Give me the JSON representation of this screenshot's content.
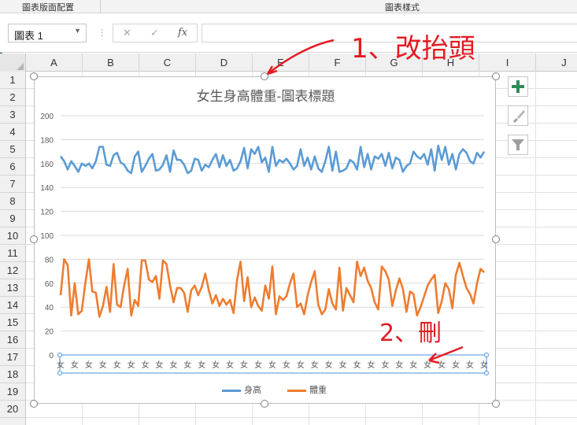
{
  "ribbon": {
    "group1": "圖表版面配置",
    "group2": "圖表樣式"
  },
  "formula_bar": {
    "name_box": "圖表 1",
    "cancel_icon": "✕",
    "enter_icon": "✓",
    "fx_icon": "fx",
    "value": ""
  },
  "columns": [
    "A",
    "B",
    "C",
    "D",
    "E",
    "F",
    "G",
    "H",
    "I",
    "J"
  ],
  "rows": [
    "1",
    "2",
    "3",
    "4",
    "5",
    "6",
    "7",
    "8",
    "9",
    "10",
    "11",
    "12",
    "13",
    "14",
    "15",
    "16",
    "17",
    "18",
    "19",
    "20"
  ],
  "chart": {
    "title": "女生身高體重-圖表標題",
    "side_buttons": [
      "plus-icon",
      "brush-icon",
      "filter-icon"
    ]
  },
  "chart_data": {
    "type": "line",
    "title": "女生身高體重-圖表標題",
    "ylim": [
      0,
      200
    ],
    "yticks": [
      "0",
      "20",
      "40",
      "60",
      "80",
      "100",
      "120",
      "140",
      "160",
      "180",
      "200"
    ],
    "category_label": "女",
    "grid": true,
    "legend_position": "bottom",
    "series": [
      {
        "name": "身高",
        "color": "#5b9bd5",
        "values": [
          166,
          162,
          155,
          162,
          158,
          153,
          160,
          158,
          160,
          156,
          162,
          174,
          174,
          159,
          158,
          167,
          169,
          161,
          159,
          154,
          152,
          166,
          170,
          153,
          158,
          164,
          168,
          154,
          155,
          159,
          167,
          153,
          171,
          163,
          163,
          159,
          152,
          154,
          164,
          163,
          154,
          159,
          157,
          163,
          168,
          157,
          167,
          158,
          163,
          154,
          156,
          162,
          173,
          156,
          172,
          168,
          174,
          161,
          165,
          153,
          174,
          158,
          163,
          161,
          164,
          160,
          155,
          158,
          172,
          158,
          165,
          155,
          166,
          156,
          153,
          162,
          174,
          154,
          170,
          153,
          154,
          156,
          163,
          161,
          155,
          174,
          157,
          168,
          155,
          166,
          164,
          168,
          158,
          169,
          156,
          165,
          163,
          153,
          158,
          160,
          170,
          166,
          164,
          168,
          159,
          172,
          154,
          175,
          163,
          174,
          159,
          168,
          155,
          168,
          172,
          169,
          162,
          160,
          169,
          165,
          170
        ]
      },
      {
        "name": "體重",
        "color": "#ed7d31",
        "values": [
          50,
          80,
          75,
          33,
          60,
          34,
          37,
          60,
          80,
          53,
          52,
          32,
          41,
          57,
          36,
          76,
          42,
          40,
          58,
          72,
          33,
          46,
          41,
          79,
          79,
          63,
          61,
          66,
          47,
          79,
          76,
          58,
          44,
          56,
          56,
          52,
          36,
          54,
          58,
          50,
          57,
          68,
          54,
          43,
          50,
          41,
          47,
          42,
          46,
          35,
          63,
          78,
          45,
          65,
          40,
          48,
          41,
          37,
          58,
          47,
          74,
          34,
          49,
          46,
          49,
          60,
          68,
          40,
          43,
          34,
          50,
          61,
          70,
          42,
          34,
          38,
          55,
          43,
          38,
          73,
          37,
          56,
          50,
          44,
          78,
          66,
          73,
          62,
          56,
          44,
          38,
          74,
          70,
          63,
          41,
          54,
          64,
          55,
          36,
          53,
          51,
          33,
          40,
          49,
          58,
          63,
          67,
          35,
          45,
          60,
          55,
          39,
          67,
          77,
          66,
          56,
          51,
          43,
          60,
          72,
          69
        ]
      }
    ]
  },
  "annotations": {
    "note1": "1、改抬頭",
    "note2": "2、刪"
  }
}
